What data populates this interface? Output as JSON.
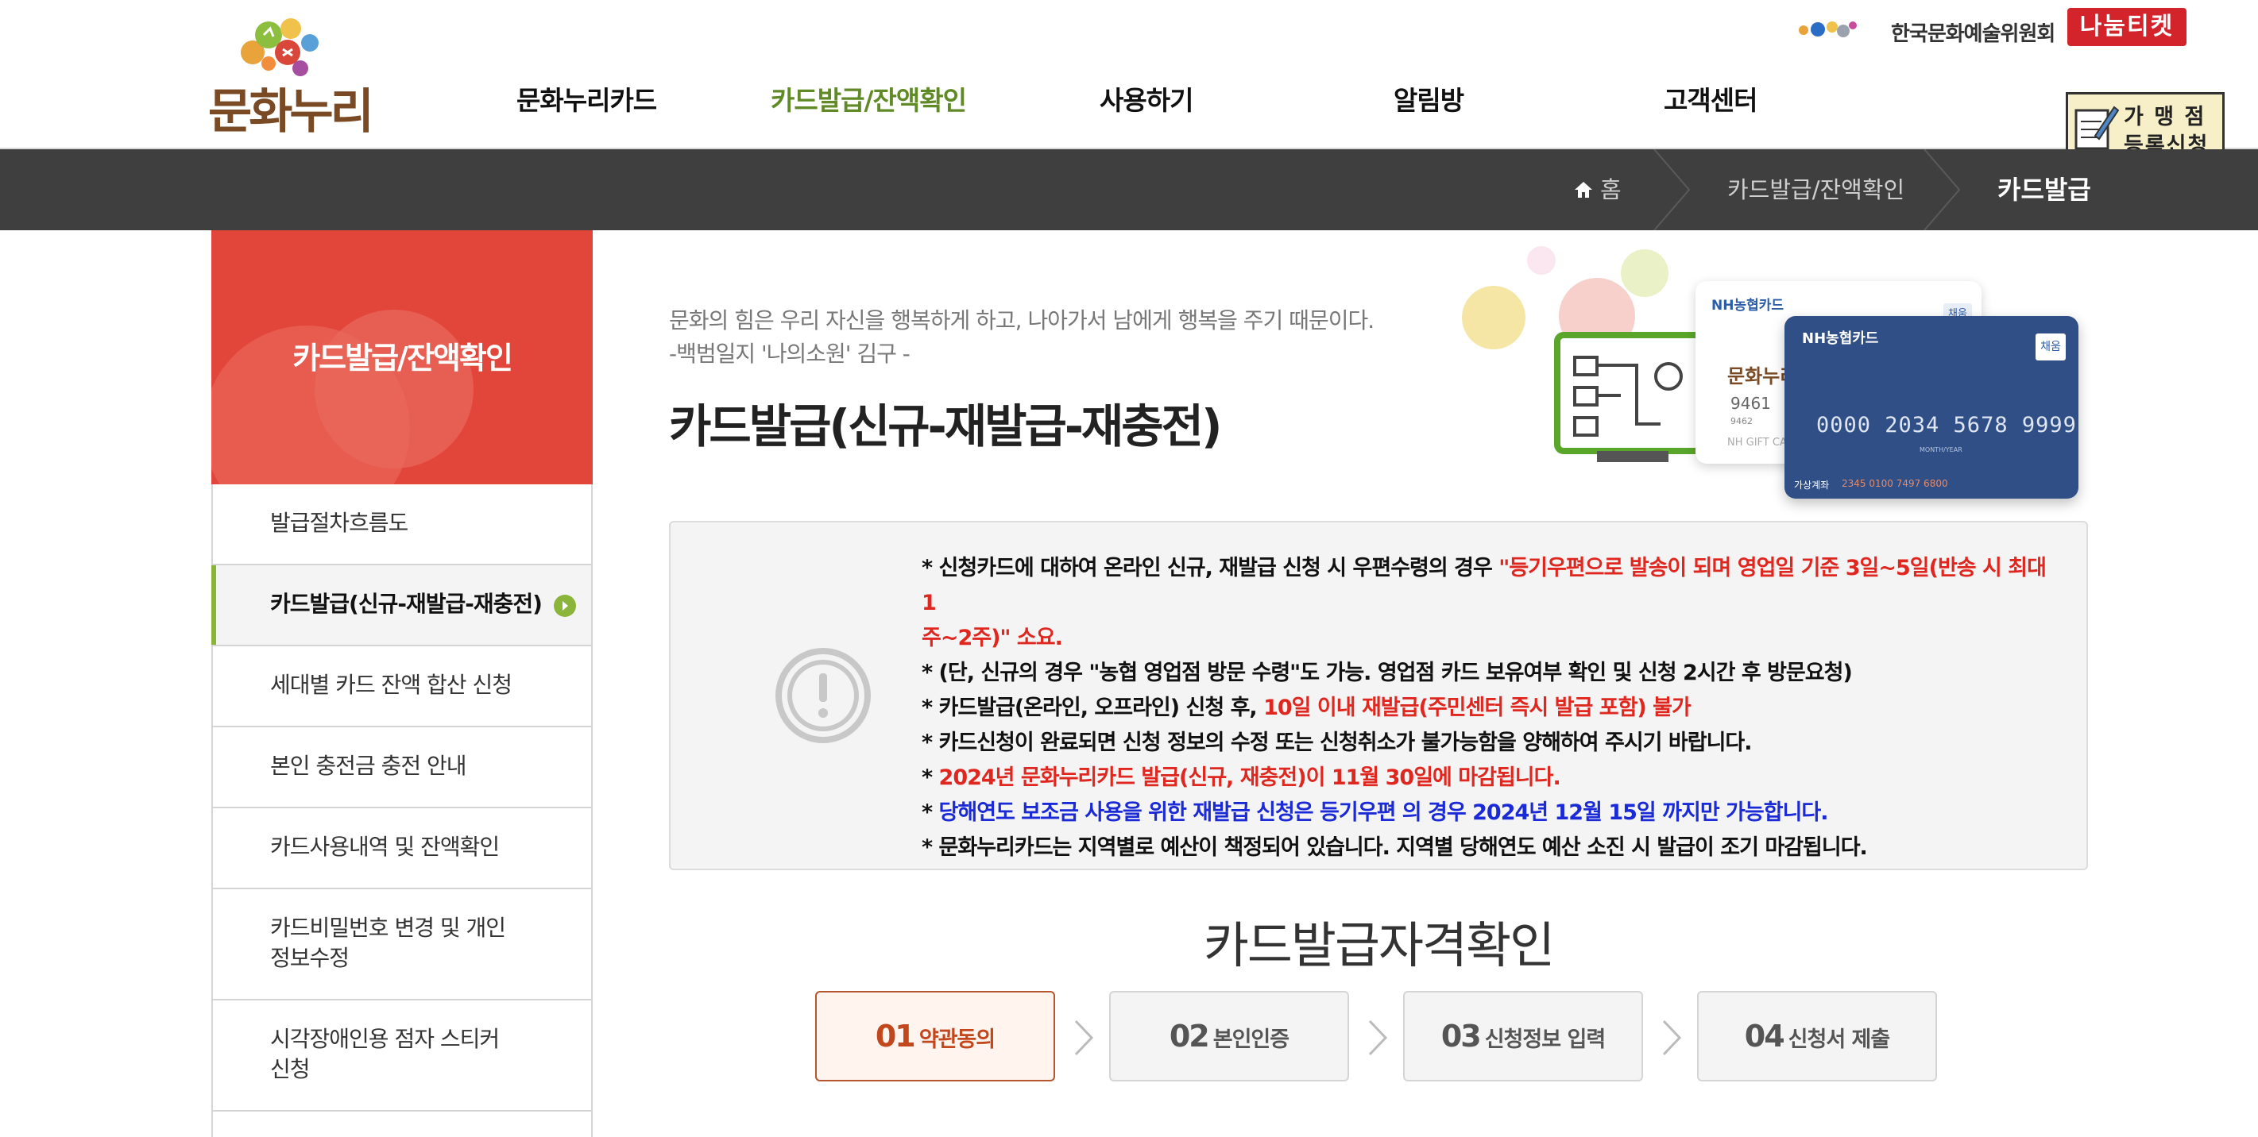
{
  "header": {
    "logo_text": "문화누리",
    "gnb": [
      {
        "label": "문화누리카드"
      },
      {
        "label": "카드발급/잔액확인"
      },
      {
        "label": "사용하기"
      },
      {
        "label": "알림방"
      },
      {
        "label": "고객센터"
      }
    ],
    "arts_council": "한국문화예술위원회",
    "nanum_ticket": "나눔티켓",
    "store_register": {
      "line1": "가 맹 점",
      "line2": "등록신청"
    }
  },
  "breadcrumb": {
    "home": "홈",
    "level1": "카드발급/잔액확인",
    "current": "카드발급"
  },
  "sidebar": {
    "title": "카드발급/잔액확인",
    "items": [
      {
        "label": "발급절차흐름도"
      },
      {
        "label": "카드발급(신규-재발급-재충전)"
      },
      {
        "label": "세대별 카드 잔액 합산 신청"
      },
      {
        "label": "본인 충전금 충전 안내"
      },
      {
        "label": "카드사용내역 및 잔액확인"
      },
      {
        "label": "카드비밀번호 변경 및 개인\n정보수정"
      },
      {
        "label": "시각장애인용 점자 스티커\n신청"
      }
    ]
  },
  "main": {
    "quote_line1": "문화의 힘은 우리 자신을 행복하게 하고, 나아가서 남에게 행복을 주기 때문이다.",
    "quote_line2": "-백범일지 '나의소원' 김구 -",
    "title": "카드발급(신규-재발급-재충전)",
    "hero": {
      "card_brand": "NH농협카드",
      "card_badge": "채움",
      "card_number": "0000 2034 5678 9999",
      "card_back_brand": "NH농협카드",
      "card_back_logo": "문화누리",
      "card_back_number": "9461",
      "card_back_sub": "9462",
      "card_back_gift": "NH GIFT CA",
      "card_back_badge": "채움",
      "card_holder_label": "가상계좌",
      "card_holder_num": "2345 0100 7497 6800",
      "card_month_label": "MONTH/YEAR"
    },
    "notice": {
      "l1a": "* 신청카드에 대하여 온라인 신규, 재발급 신청 시 우편수령의 경우 ",
      "l1b": "\"등기우편으로 발송이 되며 영업일 기준 3일~5일(반송 시 최대 1",
      "l1c": "주~2주)\" 소요.",
      "l2": "* (단, 신규의 경우 \"농협 영업점 방문 수령\"도 가능. 영업점 카드 보유여부 확인 및 신청 2시간 후 방문요청)",
      "l3a": "* 카드발급(온라인, 오프라인) 신청 후, ",
      "l3b": "10일 이내 재발급(주민센터 즉시 발급 포함) 불가",
      "l4": "* 카드신청이 완료되면 신청 정보의 수정 또는 신청취소가 불가능함을 양해하여 주시기 바랍니다.",
      "l5a": "* ",
      "l5b": "2024년 문화누리카드 발급(신규, 재충전)이 11월 30일에 마감됩니다.",
      "l6a": "* ",
      "l6b": "당해연도 보조금 사용을 위한 재발급 신청은 등기우편 의 경우 2024년 12월 15일 까지만 가능합니다.",
      "l7": "* 문화누리카드는 지역별로 예산이 책정되어 있습니다. 지역별 당해연도 예산 소진 시 발급이 조기 마감됩니다."
    },
    "steps_title": "카드발급자격확인",
    "steps": [
      {
        "num": "01",
        "label": "약관동의"
      },
      {
        "num": "02",
        "label": "본인인증"
      },
      {
        "num": "03",
        "label": "신청정보 입력"
      },
      {
        "num": "04",
        "label": "신청서 제출"
      }
    ]
  },
  "colors": {
    "accent_green": "#5f8a25",
    "sidebar_red": "#e2453a",
    "notice_red": "#e0271f",
    "notice_blue": "#1a2ad6",
    "step_active": "#c2471d",
    "crumb_bar": "#3f3f3f"
  }
}
